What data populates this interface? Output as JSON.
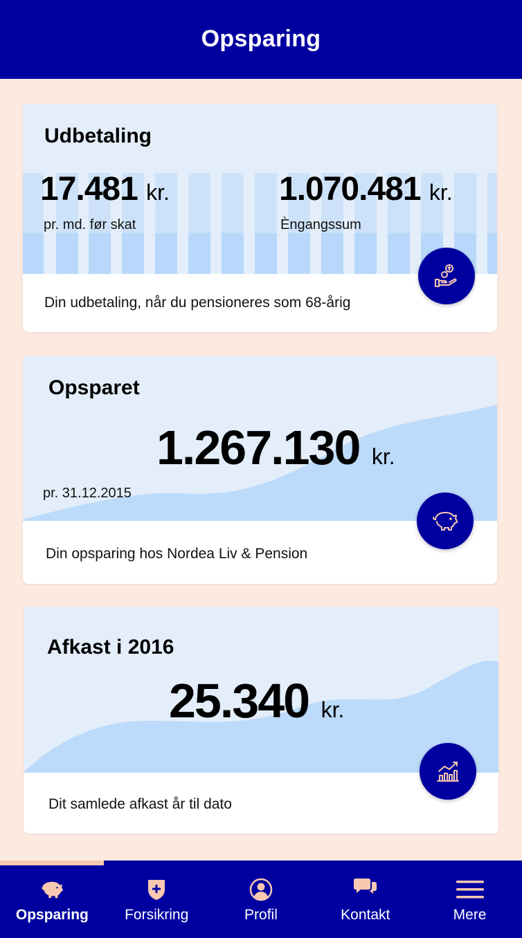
{
  "header": {
    "title": "Opsparing"
  },
  "cards": [
    {
      "title": "Udbetaling",
      "monthly_amount": "17.481",
      "monthly_unit": "kr.",
      "monthly_label": "pr. md. før skat",
      "lump_amount": "1.070.481",
      "lump_unit": "kr.",
      "lump_label": "Èngangssum",
      "footer": "Din udbetaling, når du pensioneres som 68-årig",
      "icon": "hand-coins-icon"
    },
    {
      "title": "Opsparet",
      "amount": "1.267.130",
      "unit": "kr.",
      "date_label": "pr. 31.12.2015",
      "footer": "Din opsparing hos Nordea Liv & Pension",
      "icon": "piggy-bank-icon"
    },
    {
      "title": "Afkast i 2016",
      "amount": "25.340",
      "unit": "kr.",
      "footer": "Dit samlede afkast år til dato",
      "icon": "bar-chart-trend-icon"
    }
  ],
  "tabs": [
    {
      "label": "Opsparing",
      "icon": "piggy-bank-icon",
      "active": true
    },
    {
      "label": "Forsikring",
      "icon": "shield-plus-icon",
      "active": false
    },
    {
      "label": "Profil",
      "icon": "profile-icon",
      "active": false
    },
    {
      "label": "Kontakt",
      "icon": "chat-bubbles-icon",
      "active": false
    },
    {
      "label": "Mere",
      "icon": "menu-icon",
      "active": false
    }
  ],
  "colors": {
    "primary": "#0000a0",
    "background": "#fce9e0",
    "card_top": "#e3eefa",
    "chart_fill": "#bcdafa",
    "accent": "#f8c8b0"
  }
}
